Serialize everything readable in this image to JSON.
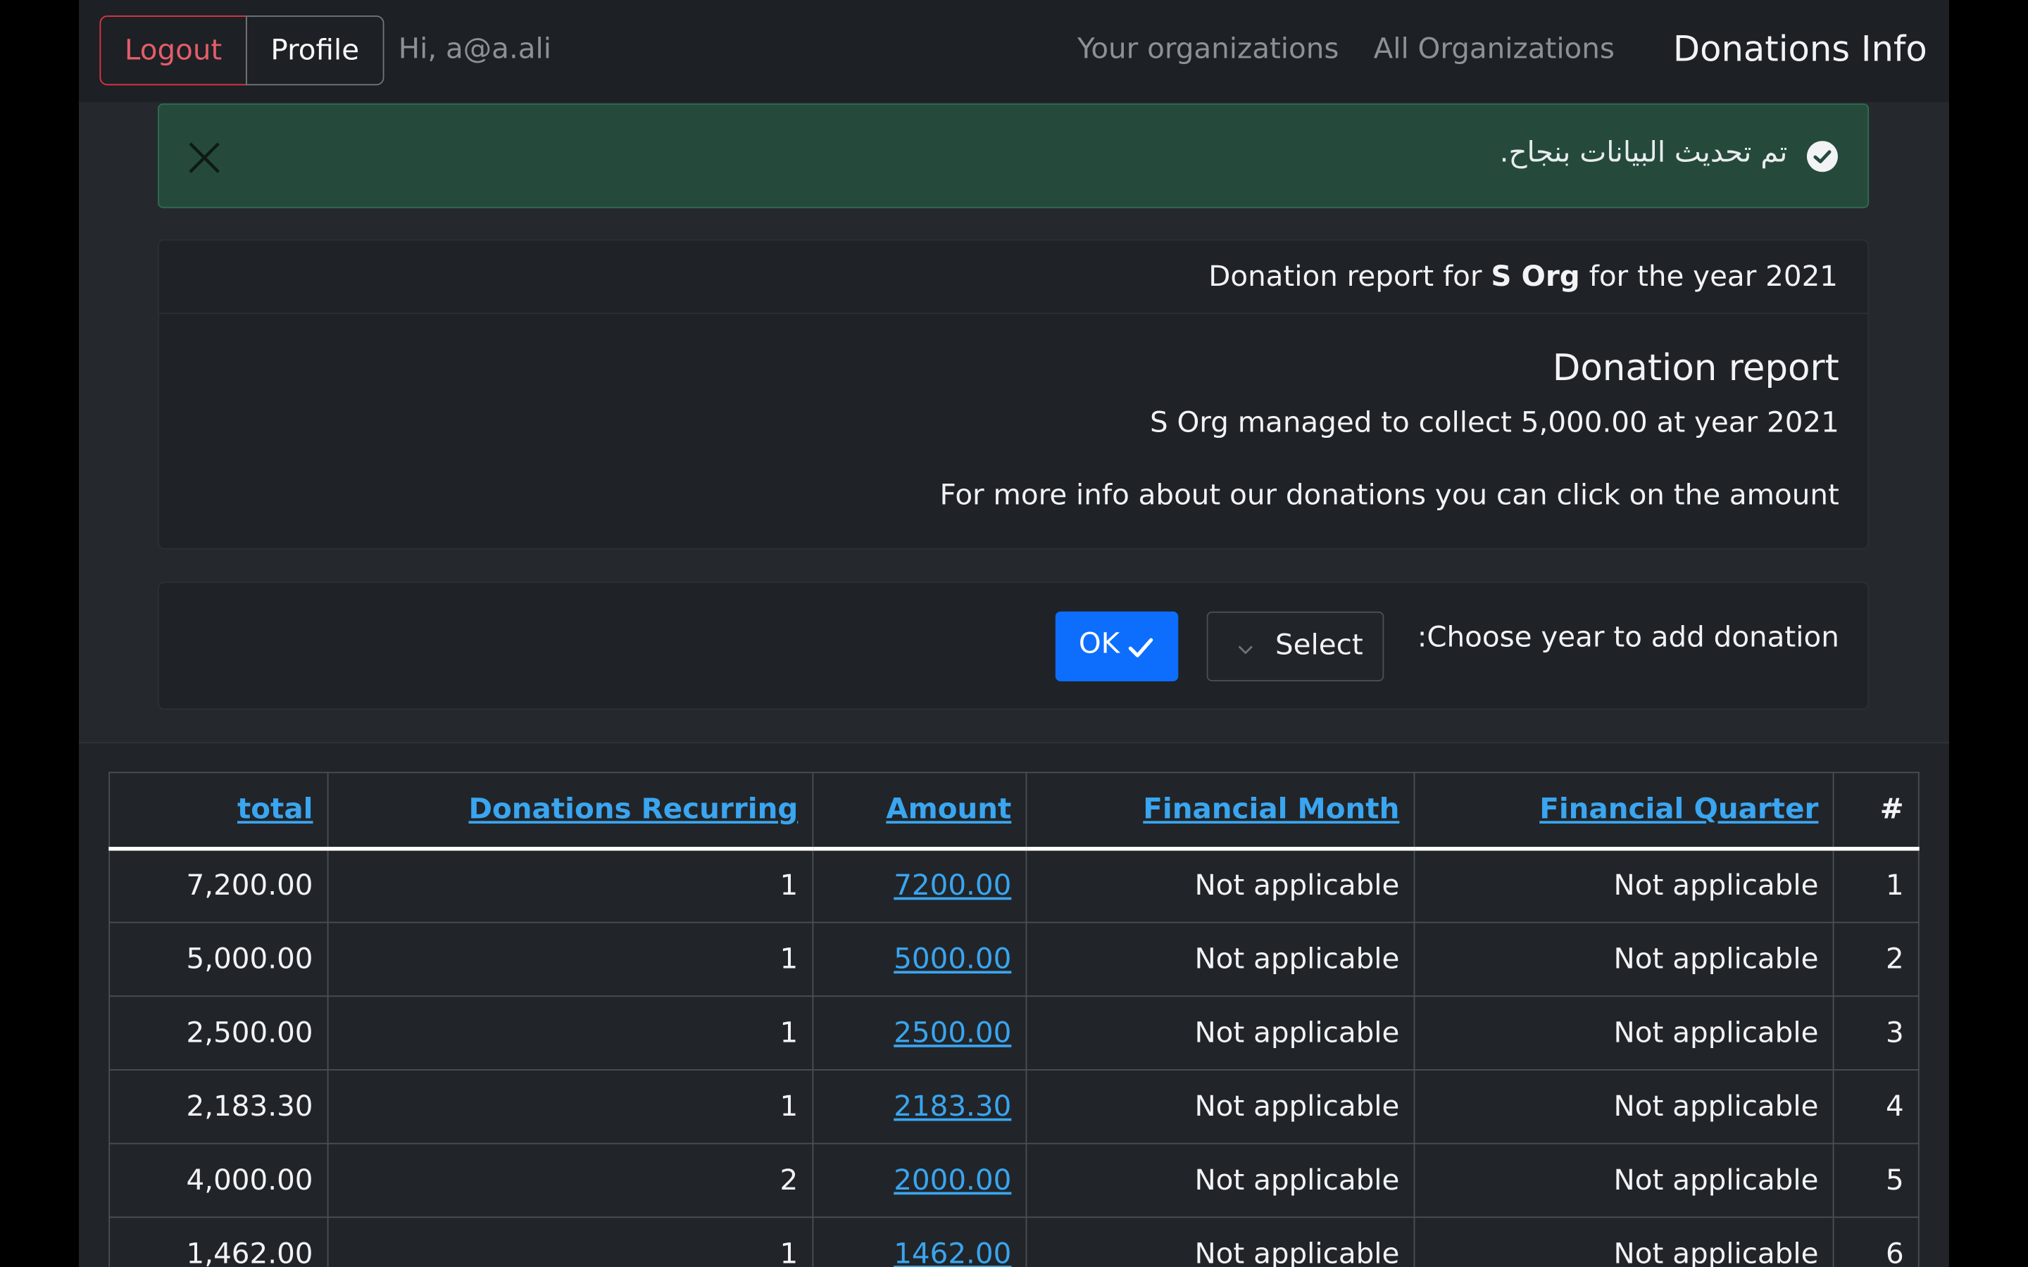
{
  "navbar": {
    "logout_label": "Logout",
    "profile_label": "Profile",
    "greeting": "Hi, a@a.ali",
    "your_orgs_label": "Your organizations",
    "all_orgs_label": "All Organizations",
    "brand": "Donations Info"
  },
  "alert": {
    "message": "تم تحديث البيانات بنجاح.",
    "close_icon": "close-icon",
    "status_icon": "check-circle-icon",
    "color": "#254a3c"
  },
  "report": {
    "header_prefix": "Donation report for ",
    "org_name": "S Org",
    "header_suffix": " for the year 2021",
    "title": "Donation report",
    "summary": "S Org managed to collect 5,000.00 at year 2021",
    "info": "For more info about our donations you can click on the amount"
  },
  "year_form": {
    "label": ":Choose year to add donation",
    "select_value": "Select",
    "ok_label": "OK",
    "ok_color": "#0d6efd"
  },
  "table": {
    "headers": {
      "total": "total",
      "recurring": "Donations Recurring",
      "amount": "Amount",
      "month": "Financial Month",
      "quarter": "Financial Quarter",
      "index": "#"
    },
    "rows": [
      {
        "total": "7,200.00",
        "recurring": "1",
        "amount": "7200.00",
        "month": "Not applicable",
        "quarter": "Not applicable",
        "index": "1"
      },
      {
        "total": "5,000.00",
        "recurring": "1",
        "amount": "5000.00",
        "month": "Not applicable",
        "quarter": "Not applicable",
        "index": "2"
      },
      {
        "total": "2,500.00",
        "recurring": "1",
        "amount": "2500.00",
        "month": "Not applicable",
        "quarter": "Not applicable",
        "index": "3"
      },
      {
        "total": "2,183.30",
        "recurring": "1",
        "amount": "2183.30",
        "month": "Not applicable",
        "quarter": "Not applicable",
        "index": "4"
      },
      {
        "total": "4,000.00",
        "recurring": "2",
        "amount": "2000.00",
        "month": "Not applicable",
        "quarter": "Not applicable",
        "index": "5"
      },
      {
        "total": "1,462.00",
        "recurring": "1",
        "amount": "1462.00",
        "month": "Not applicable",
        "quarter": "Not applicable",
        "index": "6"
      }
    ]
  }
}
